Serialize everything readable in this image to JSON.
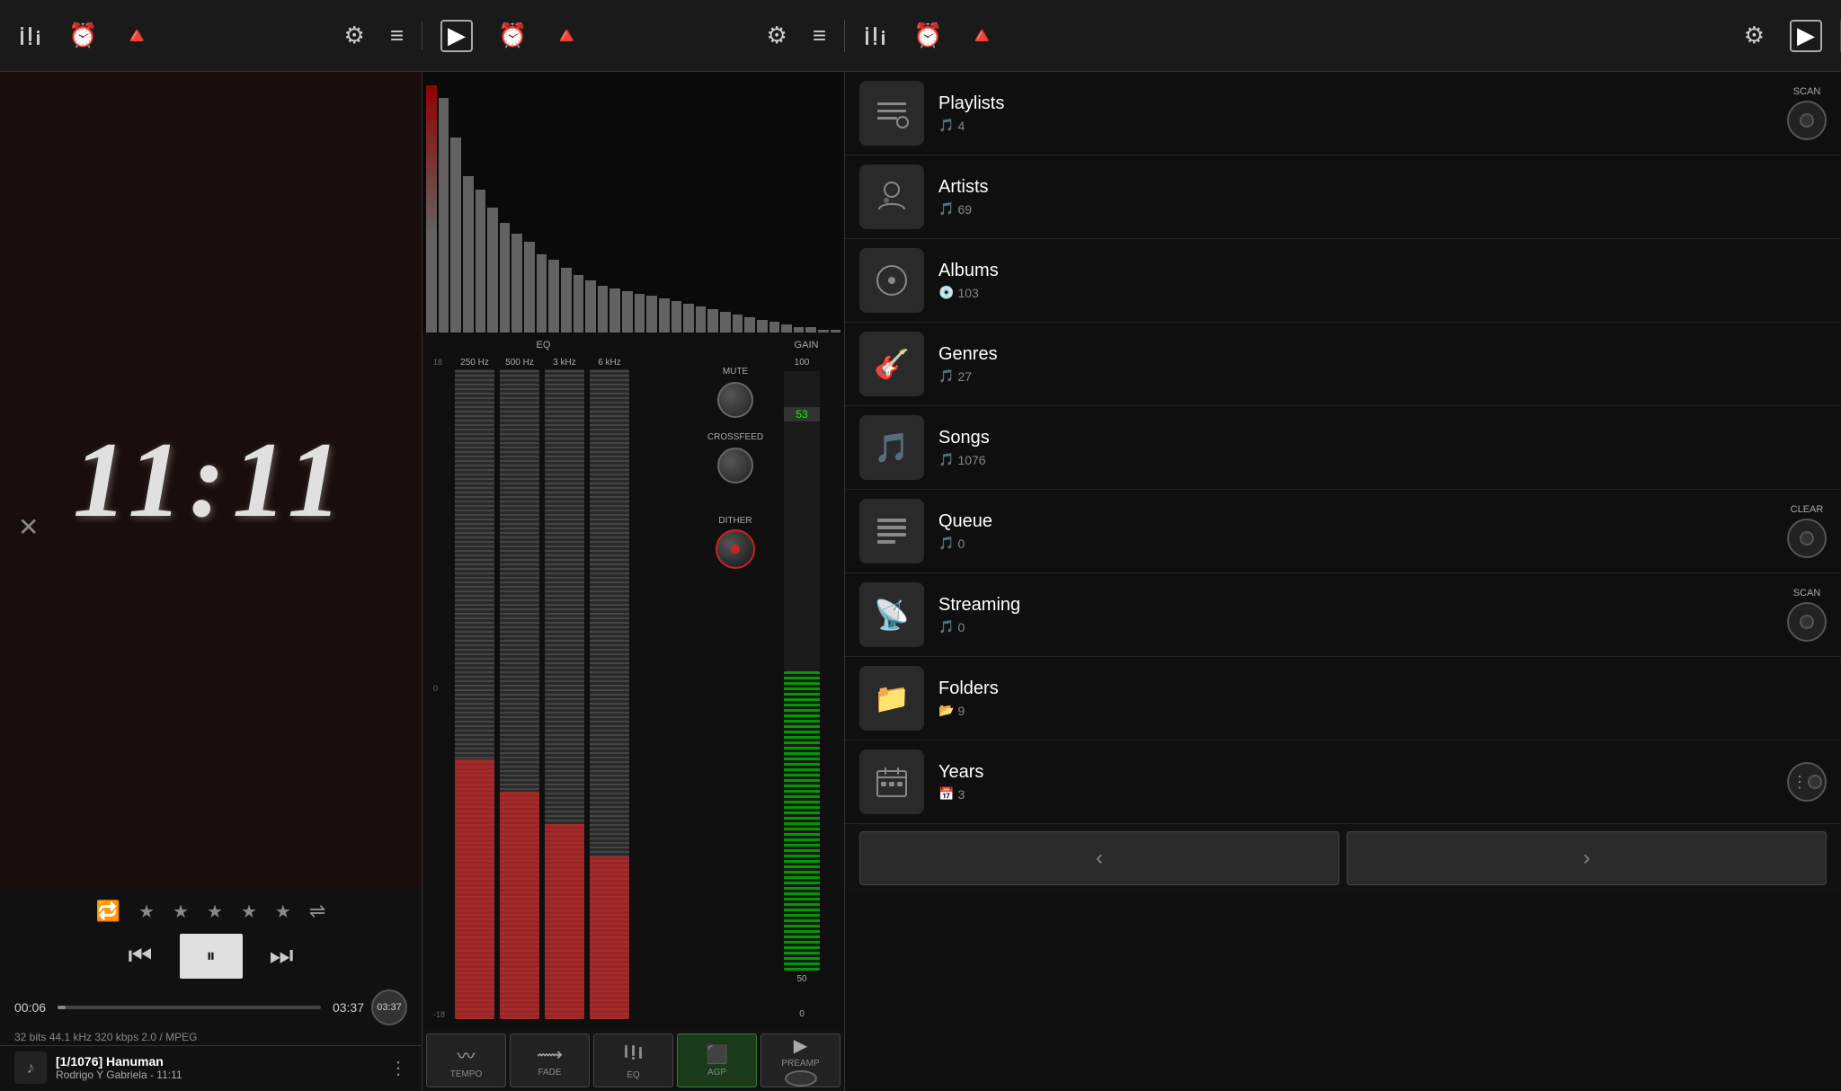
{
  "topbar": {
    "left_icons": [
      "equalizer",
      "clock",
      "alert"
    ],
    "left_icons2": [
      "settings",
      "menu"
    ],
    "mid_icons": [
      "play",
      "clock",
      "alert"
    ],
    "mid_icons2": [
      "settings",
      "menu"
    ],
    "mid_icons3": [
      "equalizer",
      "clock",
      "alert"
    ],
    "right_icons": [
      "settings",
      "play"
    ]
  },
  "player": {
    "clock": "11:11",
    "current_time": "00:06",
    "total_time": "03:37",
    "file_info": "32 bits    44.1 kHz    320 kbps    2.0 / MPEG",
    "track_name": "[1/1076] Hanuman",
    "track_artist": "Rodrigo Y Gabriela - 11:11",
    "play_icon": "⏸",
    "prev_icon": "⏮",
    "next_icon": "⏭",
    "stars": [
      "★",
      "★",
      "★",
      "★",
      "★"
    ]
  },
  "eq": {
    "section_label": "EQ",
    "gain_label": "GAIN",
    "gain_value": "53",
    "mute_label": "MUTE",
    "crossfeed_label": "CROSSFEED",
    "dither_label": "DITHER",
    "bands": [
      {
        "freq": "250 Hz",
        "level": 45
      },
      {
        "freq": "500 Hz",
        "level": 40
      },
      {
        "freq": "3 kHz",
        "level": 35
      },
      {
        "freq": "6 kHz",
        "level": 30
      }
    ],
    "db_marks": [
      "18",
      "0",
      "-18"
    ],
    "gain_marks": [
      "100",
      "50",
      "0"
    ],
    "buttons": [
      {
        "id": "tempo",
        "label": "TEMPO",
        "icon": "〰"
      },
      {
        "id": "fade",
        "label": "FADE",
        "icon": "⟿"
      },
      {
        "id": "eq_btn",
        "label": "EQ",
        "icon": "⧖"
      },
      {
        "id": "agp",
        "label": "AGP",
        "icon": "⬛"
      },
      {
        "id": "preamp",
        "label": "PREAMP",
        "icon": "▶"
      }
    ]
  },
  "library": {
    "items": [
      {
        "id": "playlists",
        "name": "Playlists",
        "count": "4",
        "icon": "📋",
        "has_scan": true
      },
      {
        "id": "artists",
        "name": "Artists",
        "count": "69",
        "icon": "🎤",
        "has_scan": false
      },
      {
        "id": "albums",
        "name": "Albums",
        "count": "103",
        "icon": "💿",
        "has_scan": false
      },
      {
        "id": "genres",
        "name": "Genres",
        "count": "27",
        "icon": "🎸",
        "has_scan": false
      },
      {
        "id": "songs",
        "name": "Songs",
        "count": "1076",
        "icon": "🎵",
        "has_scan": false
      },
      {
        "id": "queue",
        "name": "Queue",
        "count": "0",
        "icon": "📑",
        "has_scan": false,
        "has_clear": true
      },
      {
        "id": "streaming",
        "name": "Streaming",
        "count": "0",
        "icon": "📡",
        "has_scan": true
      },
      {
        "id": "folders",
        "name": "Folders",
        "count": "9",
        "icon": "📁",
        "has_scan": false
      },
      {
        "id": "years",
        "name": "Years",
        "count": "3",
        "icon": "🗓",
        "has_scan": false
      }
    ],
    "scan_label": "SCAN",
    "clear_label": "CLEAR",
    "nav_prev": "‹",
    "nav_next": "›"
  },
  "vis_bars": [
    95,
    90,
    75,
    60,
    55,
    48,
    42,
    38,
    35,
    30,
    28,
    25,
    22,
    20,
    18,
    17,
    16,
    15,
    14,
    13,
    12,
    11,
    10,
    9,
    8,
    7,
    6,
    5,
    4,
    3,
    2,
    2,
    1,
    1
  ]
}
